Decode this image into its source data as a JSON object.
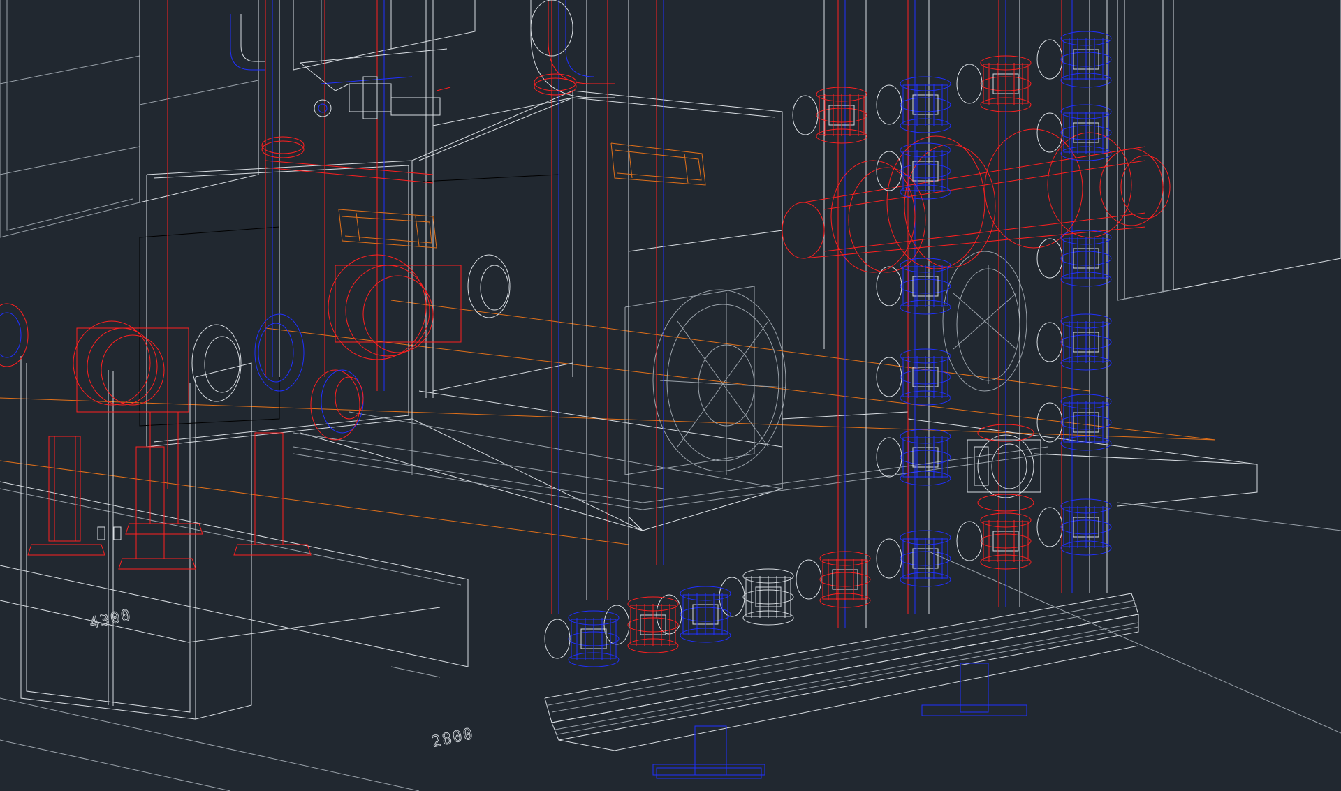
{
  "drawing": {
    "dimensions": [
      {
        "text": "4300"
      },
      {
        "text": "2800"
      }
    ],
    "colors": {
      "background": "#212830",
      "outline": "#d8dde2",
      "red_component": "#ff2020",
      "blue_component": "#2030ff",
      "orange_line": "#e0701a"
    }
  }
}
